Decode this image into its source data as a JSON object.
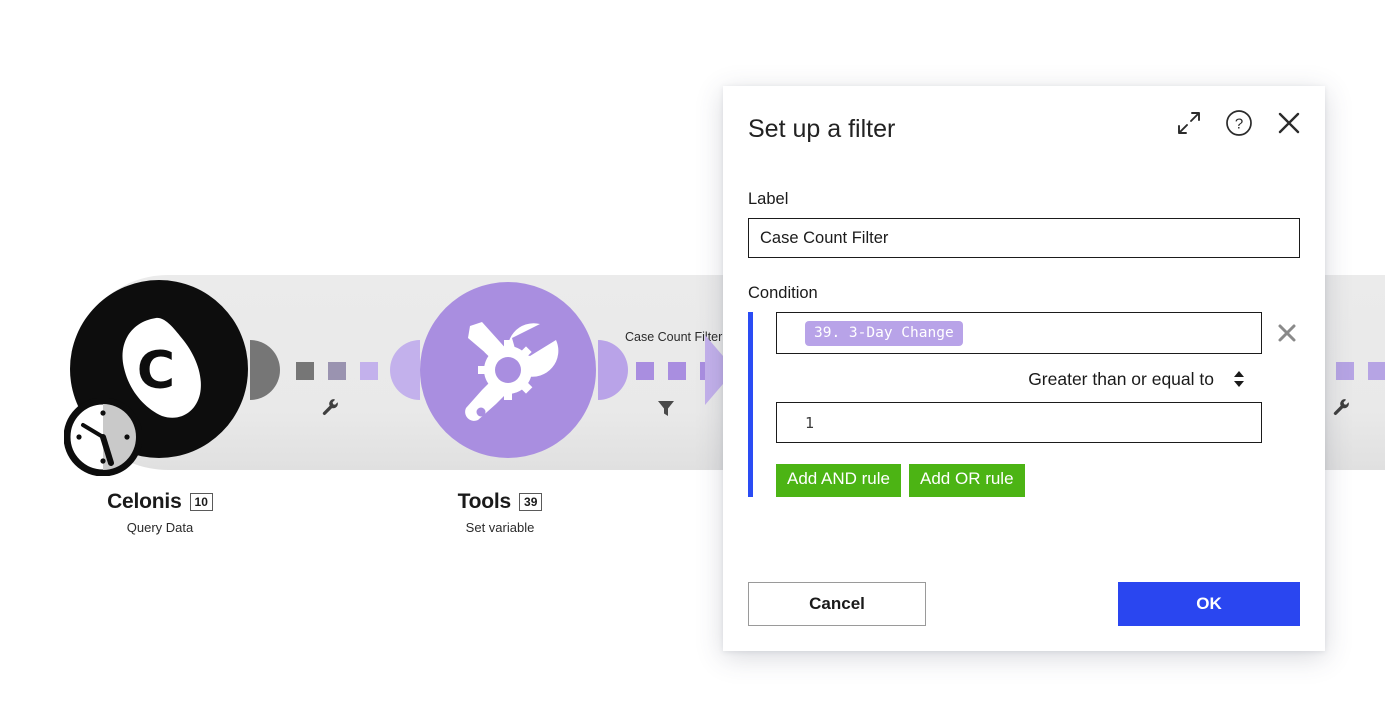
{
  "canvas": {
    "nodes": [
      {
        "id": "celonis",
        "title": "Celonis",
        "badge": "10",
        "subtitle": "Query Data",
        "icon": "celonis-logo-icon",
        "accent": "#0d0d0d"
      },
      {
        "id": "tools",
        "title": "Tools",
        "badge": "39",
        "subtitle": "Set variable",
        "icon": "tools-wrench-screwdriver-icon",
        "accent": "#a98ee0"
      }
    ],
    "edges": [
      {
        "id": "edge-1",
        "label": "",
        "icon": "wrench-icon"
      },
      {
        "id": "edge-2",
        "label": "Case Count Filter",
        "icon": "funnel-icon"
      },
      {
        "id": "edge-3",
        "label": "",
        "icon": "wrench-icon"
      }
    ]
  },
  "dialog": {
    "title": "Set up a filter",
    "header_actions": {
      "expand": "expand-icon",
      "help": "help-icon",
      "close": "close-icon"
    },
    "label_field": {
      "label": "Label",
      "value": "Case Count Filter",
      "placeholder": "Enter a label"
    },
    "condition": {
      "label": "Condition",
      "rule": {
        "token": "39. 3-Day Change",
        "operator": "Greater than or equal to",
        "value": "1",
        "remove": "remove-rule-icon"
      },
      "add_and_label": "Add AND rule",
      "add_or_label": "Add OR rule"
    },
    "footer": {
      "cancel_label": "Cancel",
      "ok_label": "OK"
    },
    "colors": {
      "rail": "#2a4cf4",
      "primary": "#2a46f0",
      "green": "#4cb414",
      "token": "#b8a3e8"
    }
  }
}
